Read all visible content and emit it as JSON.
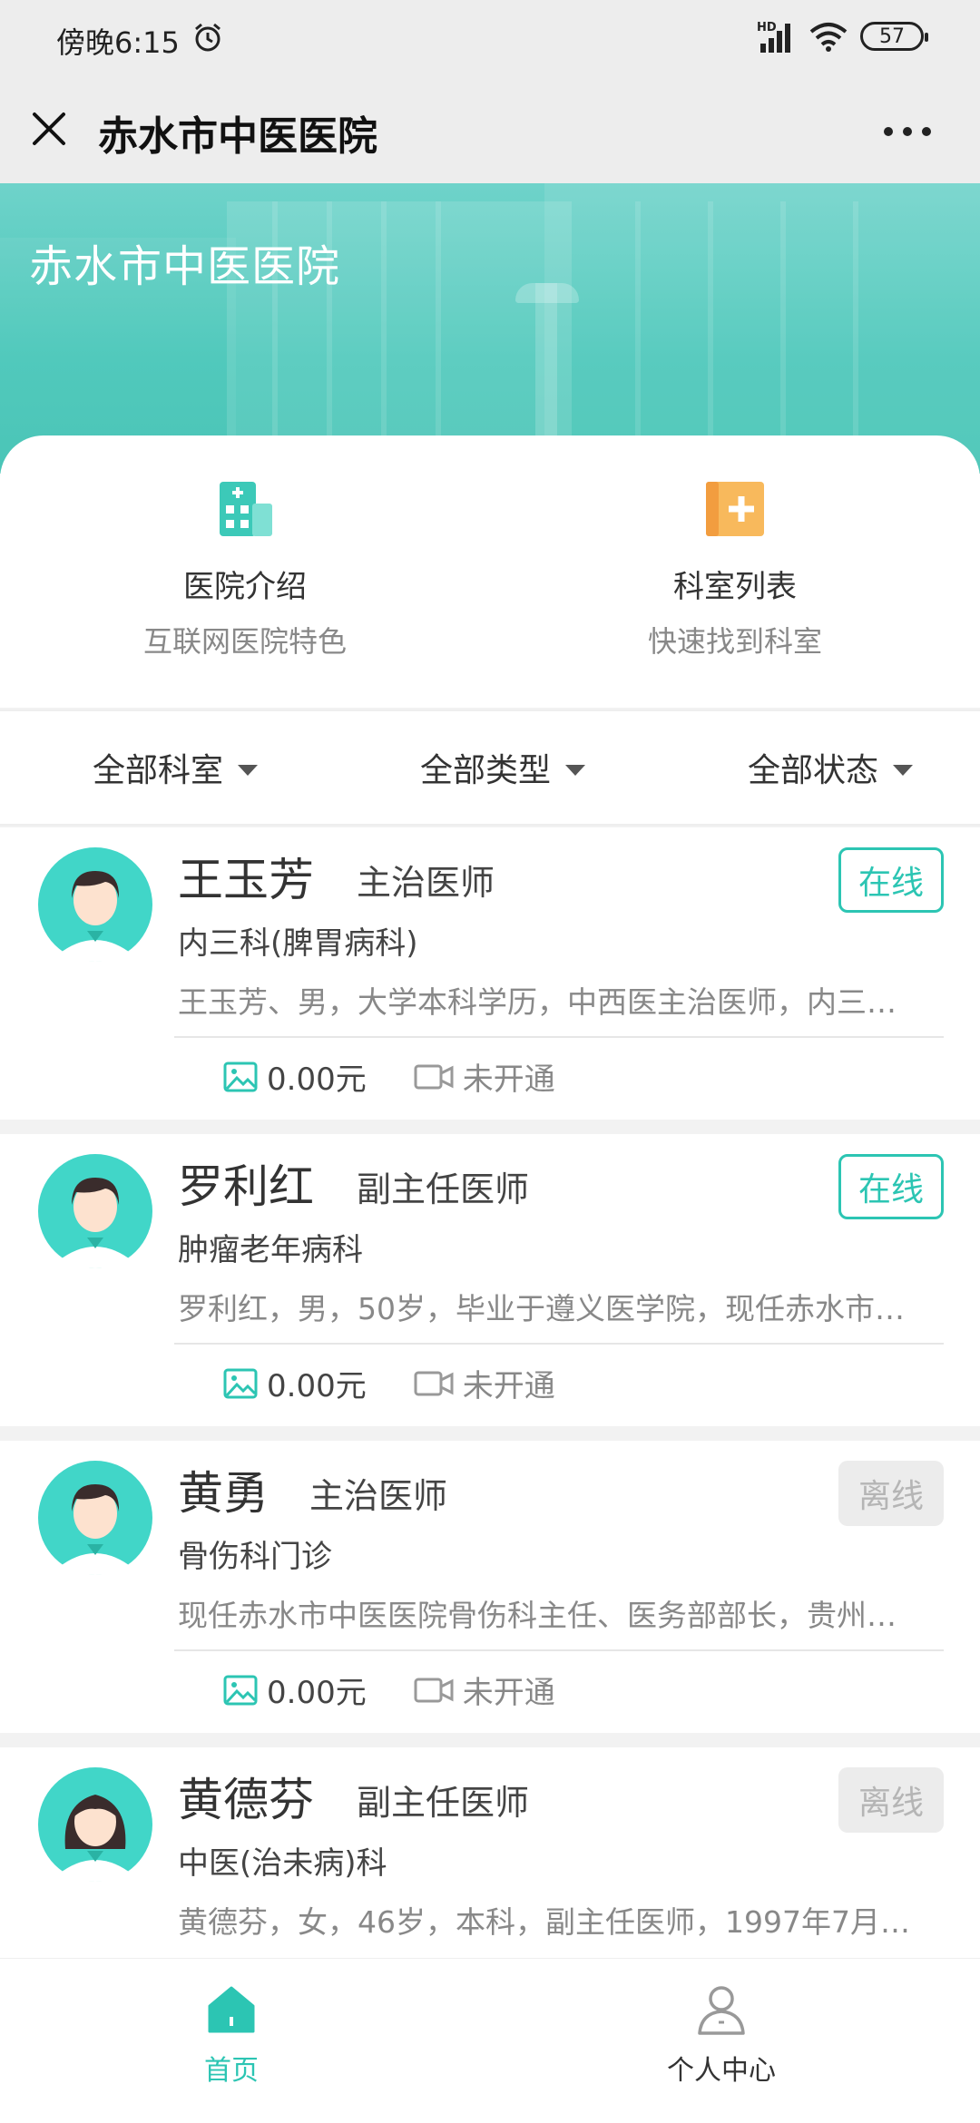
{
  "status_bar": {
    "time": "傍晚6:15",
    "battery": "57",
    "network": "HD"
  },
  "nav": {
    "title": "赤水市中医医院"
  },
  "banner": {
    "title": "赤水市中医医院"
  },
  "entries": [
    {
      "title": "医院介绍",
      "subtitle": "互联网医院特色",
      "icon": "hospital-building-icon",
      "color": "#3cc9b8"
    },
    {
      "title": "科室列表",
      "subtitle": "快速找到科室",
      "icon": "medical-folder-icon",
      "color": "#f6a64b"
    }
  ],
  "filters": [
    {
      "label": "全部科室"
    },
    {
      "label": "全部类型"
    },
    {
      "label": "全部状态"
    }
  ],
  "doctors": [
    {
      "name": "王玉芳",
      "title": "主治医师",
      "department": "内三科(脾胃病科)",
      "description": "王玉芳、男，大学本科学历，中西医主治医师，内三…",
      "price": "0.00元",
      "video": "未开通",
      "status": "在线",
      "gender": "male"
    },
    {
      "name": "罗利红",
      "title": "副主任医师",
      "department": "肿瘤老年病科",
      "description": "罗利红，男，50岁，毕业于遵义医学院，现任赤水市…",
      "price": "0.00元",
      "video": "未开通",
      "status": "在线",
      "gender": "male"
    },
    {
      "name": "黄勇",
      "title": "主治医师",
      "department": "骨伤科门诊",
      "description": "现任赤水市中医医院骨伤科主任、医务部部长，贵州…",
      "price": "0.00元",
      "video": "未开通",
      "status": "离线",
      "gender": "male"
    },
    {
      "name": "黄德芬",
      "title": "副主任医师",
      "department": "中医(治未病)科",
      "description": "黄德芬，女，46岁，本科，副主任医师，1997年7月…",
      "price": "",
      "video": "",
      "status": "离线",
      "gender": "female"
    }
  ],
  "tabs": [
    {
      "label": "首页",
      "icon": "home-icon",
      "active": true
    },
    {
      "label": "个人中心",
      "icon": "user-icon",
      "active": false
    }
  ],
  "colors": {
    "accent": "#2cc5b3",
    "banner": "#47c6b8",
    "orange": "#f6a64b",
    "offline_bg": "#ececec"
  }
}
